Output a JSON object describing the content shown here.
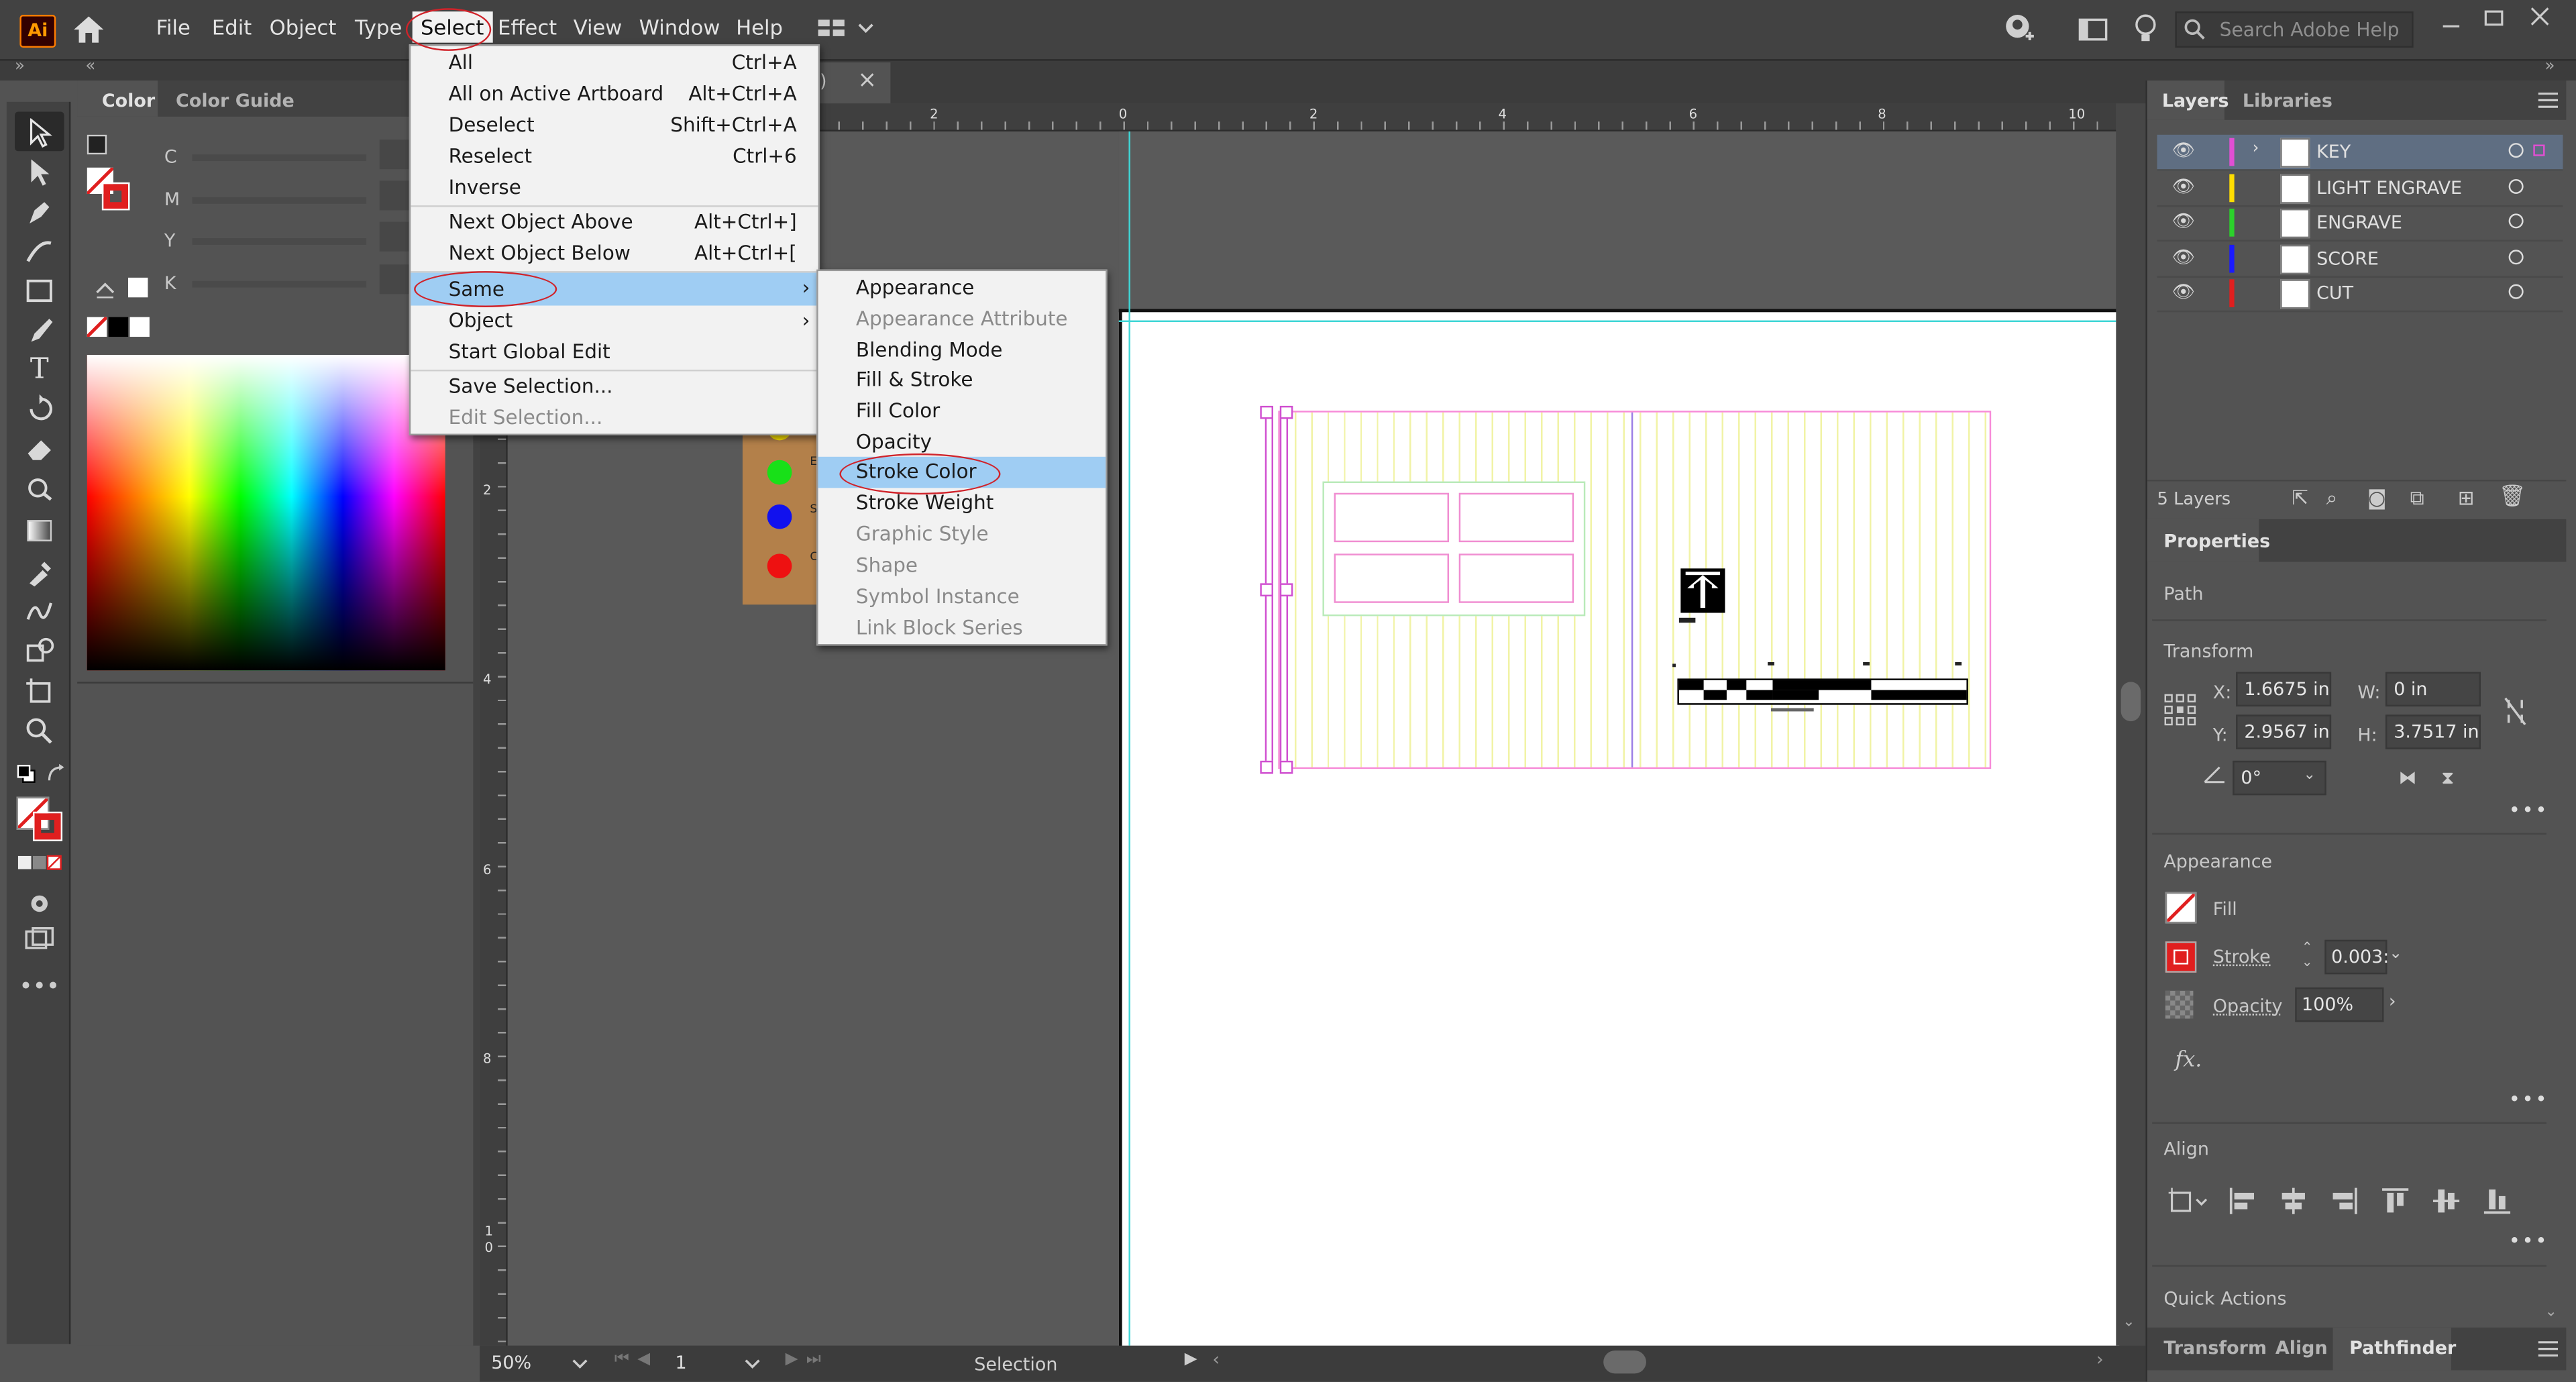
{
  "app": {
    "logo": "Ai"
  },
  "menubar": {
    "items": [
      "File",
      "Edit",
      "Object",
      "Type",
      "Select",
      "Effect",
      "View",
      "Window",
      "Help"
    ],
    "search_placeholder": "Search Adobe Help"
  },
  "doc_tab": {
    "suffix": ")",
    "close": "×"
  },
  "select_menu": {
    "items": [
      {
        "label": "All",
        "shortcut": "Ctrl+A"
      },
      {
        "label": "All on Active Artboard",
        "shortcut": "Alt+Ctrl+A"
      },
      {
        "label": "Deselect",
        "shortcut": "Shift+Ctrl+A"
      },
      {
        "label": "Reselect",
        "shortcut": "Ctrl+6"
      },
      {
        "label": "Inverse",
        "shortcut": ""
      },
      {
        "label": "Next Object Above",
        "shortcut": "Alt+Ctrl+]"
      },
      {
        "label": "Next Object Below",
        "shortcut": "Alt+Ctrl+["
      },
      {
        "label": "Same",
        "shortcut": "›"
      },
      {
        "label": "Object",
        "shortcut": "›"
      },
      {
        "label": "Start Global Edit",
        "shortcut": ""
      },
      {
        "label": "Save Selection...",
        "shortcut": ""
      },
      {
        "label": "Edit Selection...",
        "shortcut": ""
      }
    ]
  },
  "same_menu": {
    "items": [
      "Appearance",
      "Appearance Attribute",
      "Blending Mode",
      "Fill & Stroke",
      "Fill Color",
      "Opacity",
      "Stroke Color",
      "Stroke Weight",
      "Graphic Style",
      "Shape",
      "Symbol Instance",
      "Link Block Series"
    ]
  },
  "color_panel": {
    "tabs": [
      "Color",
      "Color Guide"
    ],
    "channels": [
      "C",
      "M",
      "Y",
      "K"
    ]
  },
  "ruler": {
    "h_ticks": [
      "2",
      "0",
      "2",
      "4",
      "6",
      "8",
      "10"
    ],
    "v_ticks": [
      "2",
      "4",
      "6",
      "8",
      "1\n0"
    ]
  },
  "swatch_letters": [
    "E",
    "S",
    "C"
  ],
  "status": {
    "zoom": "50%",
    "artboard": "1",
    "tool": "Selection"
  },
  "layers": {
    "tabs": [
      "Layers",
      "Libraries"
    ],
    "rows": [
      {
        "name": "KEY",
        "color": "#e14fd3"
      },
      {
        "name": "LIGHT ENGRAVE",
        "color": "#ffdd00"
      },
      {
        "name": "ENGRAVE",
        "color": "#2bd12b"
      },
      {
        "name": "SCORE",
        "color": "#1a1aff"
      },
      {
        "name": "CUT",
        "color": "#e01f1f"
      }
    ],
    "count": "5 Layers"
  },
  "properties": {
    "tab": "Properties",
    "kind": "Path",
    "transform": {
      "title": "Transform",
      "x_label": "X:",
      "x": "1.6675 in",
      "y_label": "Y:",
      "y": "2.9567 in",
      "w_label": "W:",
      "w": "0 in",
      "h_label": "H:",
      "h": "3.7517 in",
      "angle": "0°"
    },
    "appearance": {
      "title": "Appearance",
      "fill": "Fill",
      "stroke": "Stroke",
      "stroke_value": "0.003:",
      "opacity": "Opacity",
      "opacity_value": "100%",
      "fx": "fx."
    },
    "align": {
      "title": "Align"
    },
    "quick_actions": "Quick Actions",
    "bottom_tabs": [
      "Transform",
      "Align",
      "Pathfinder"
    ]
  },
  "colors": {
    "accent_highlight": "#9fcdf3",
    "annotation_red": "#d0232a",
    "guide": "#3fd6d6"
  }
}
